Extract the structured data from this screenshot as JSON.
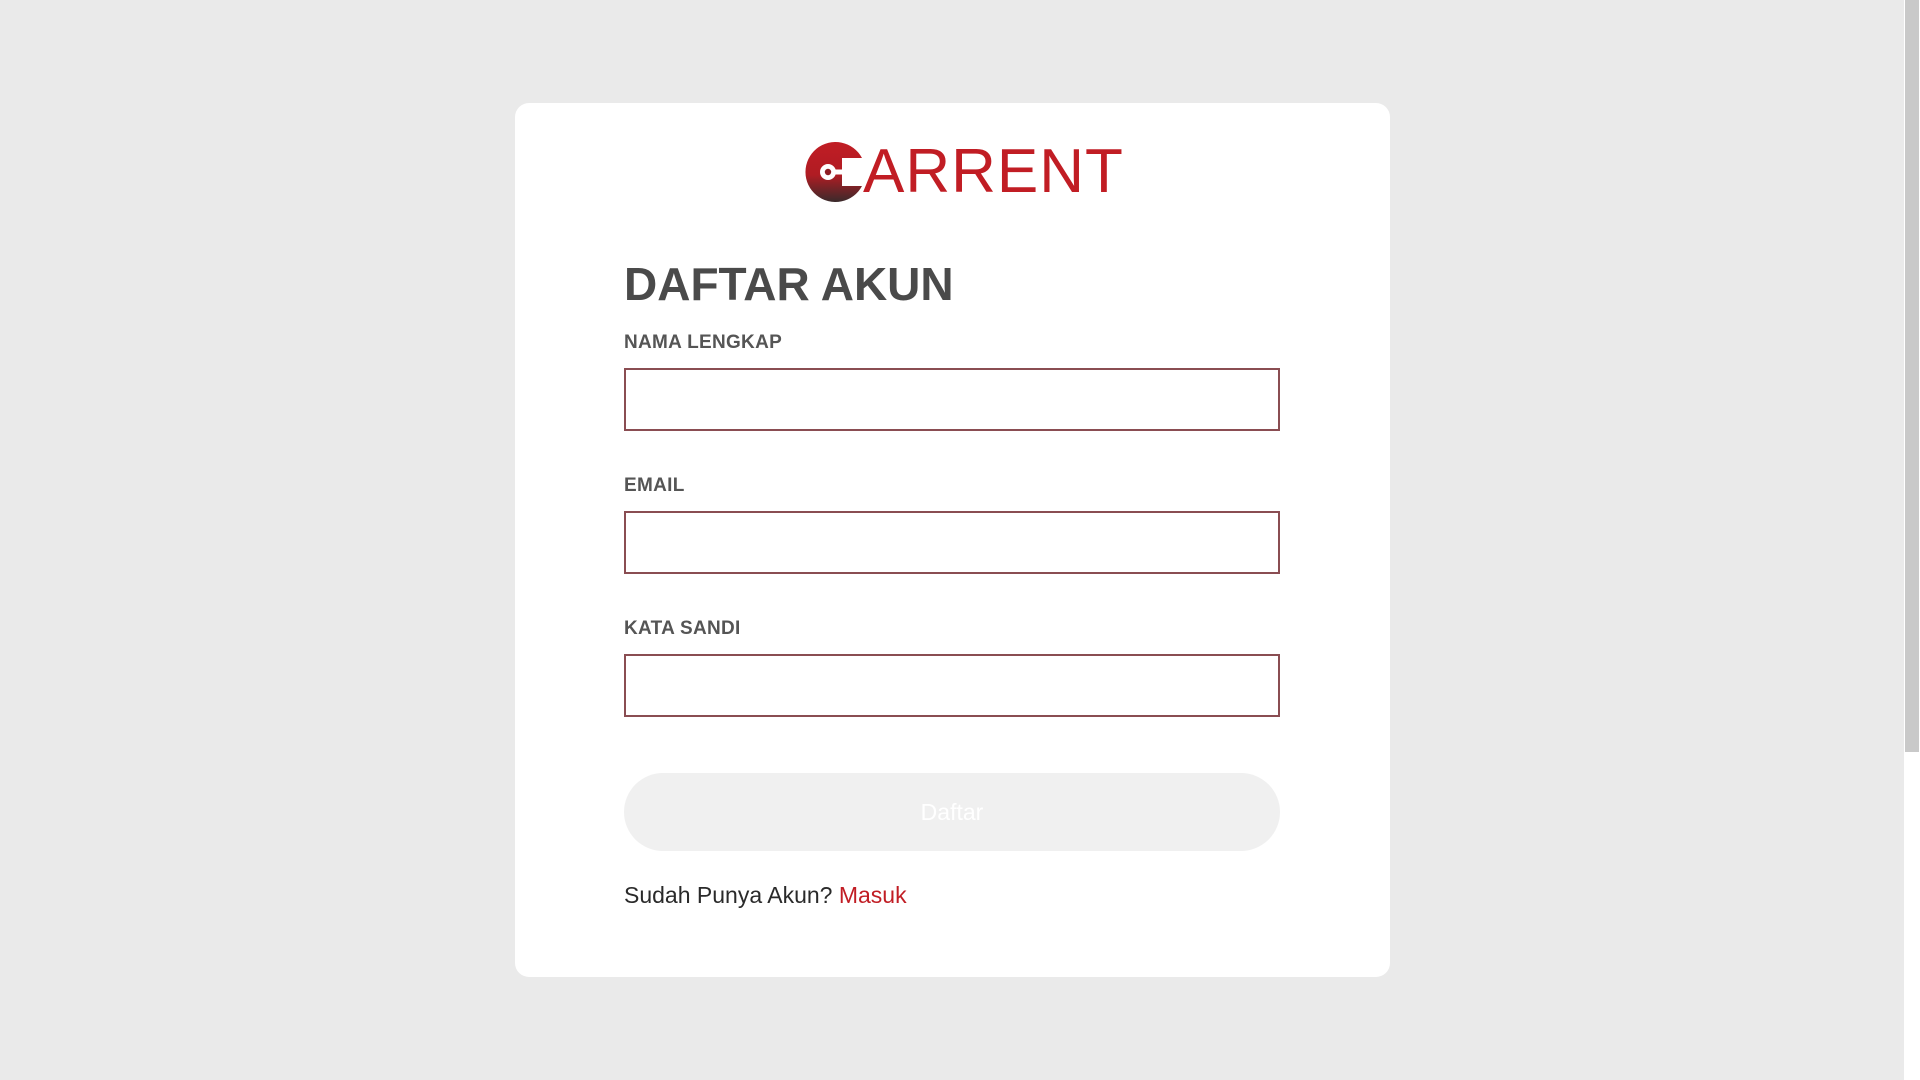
{
  "brand": {
    "logo_text": "ARRENT",
    "logo_icon": "car-key-icon",
    "primary_color": "#c11d24",
    "logo_gradient_dark": "#3a2a2b"
  },
  "form": {
    "title": "DAFTAR AKUN",
    "fields": [
      {
        "label": "NAMA LENGKAP",
        "value": "",
        "type": "text"
      },
      {
        "label": "EMAIL",
        "value": "",
        "type": "email"
      },
      {
        "label": "KATA SANDI",
        "value": "",
        "type": "password"
      }
    ],
    "submit_label": "Daftar",
    "submit_state": "disabled",
    "footer_text": "Sudah Punya Akun?",
    "login_link_label": "Masuk"
  },
  "colors": {
    "page_background": "#eaeaea",
    "card_background": "#ffffff",
    "input_border": "#8a4d52",
    "button_background_disabled": "#f0f0f0",
    "heading": "#4a4a4a"
  }
}
